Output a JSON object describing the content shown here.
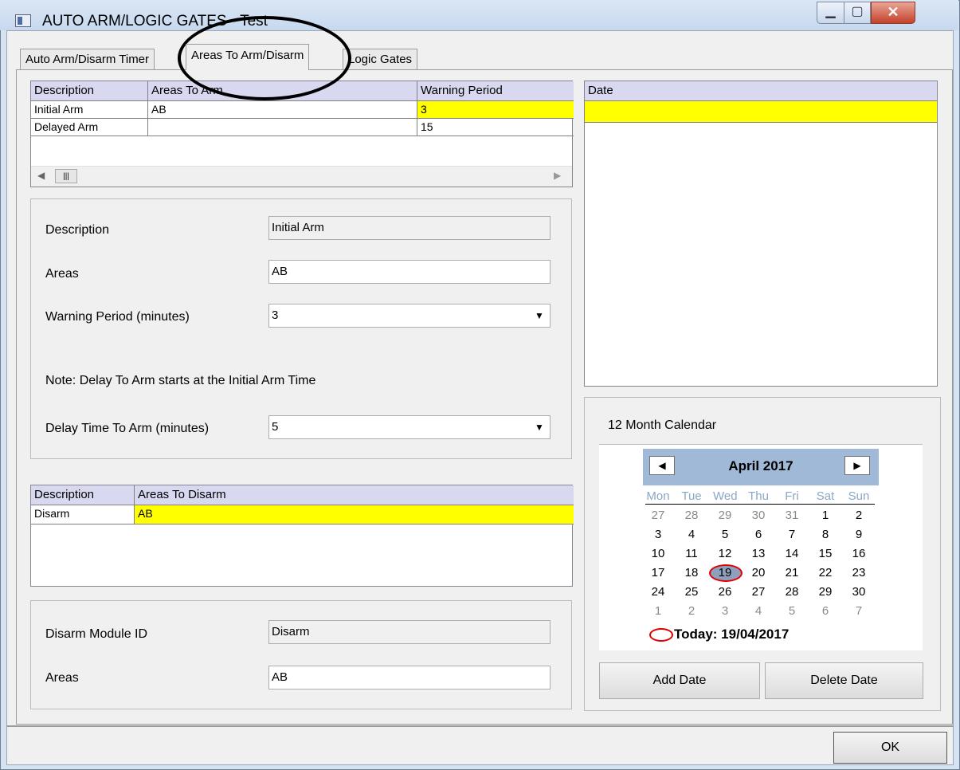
{
  "window": {
    "title": "AUTO ARM/LOGIC GATES - Test"
  },
  "tabs": [
    {
      "label": "Auto Arm/Disarm Timer"
    },
    {
      "label": "Areas To Arm/Disarm"
    },
    {
      "label": "Logic Gates"
    }
  ],
  "arm_grid": {
    "headers": [
      "Description",
      "Areas To Arm",
      "Warning Period"
    ],
    "rows": [
      {
        "description": "Initial Arm",
        "areas": "AB",
        "warning": "3"
      },
      {
        "description": "Delayed Arm",
        "areas": "",
        "warning": "15"
      }
    ]
  },
  "arm_details": {
    "description_label": "Description",
    "description_value": "Initial Arm",
    "areas_label": "Areas",
    "areas_value": "AB",
    "warning_label": "Warning Period (minutes)",
    "warning_value": "3",
    "note": "Note: Delay To Arm starts at the Initial Arm Time",
    "delay_label": "Delay Time To Arm (minutes)",
    "delay_value": "5"
  },
  "disarm_grid": {
    "headers": [
      "Description",
      "Areas To Disarm"
    ],
    "rows": [
      {
        "description": "Disarm",
        "areas": "AB"
      }
    ]
  },
  "disarm_details": {
    "module_label": "Disarm Module ID",
    "module_value": "Disarm",
    "areas_label": "Areas",
    "areas_value": "AB"
  },
  "date_grid": {
    "header": "Date"
  },
  "calendar": {
    "label": "12 Month Calendar",
    "month": "April 2017",
    "weekdays": [
      "Mon",
      "Tue",
      "Wed",
      "Thu",
      "Fri",
      "Sat",
      "Sun"
    ],
    "weeks": [
      [
        "27",
        "28",
        "29",
        "30",
        "31",
        "1",
        "2"
      ],
      [
        "3",
        "4",
        "5",
        "6",
        "7",
        "8",
        "9"
      ],
      [
        "10",
        "11",
        "12",
        "13",
        "14",
        "15",
        "16"
      ],
      [
        "17",
        "18",
        "19",
        "20",
        "21",
        "22",
        "23"
      ],
      [
        "24",
        "25",
        "26",
        "27",
        "28",
        "29",
        "30"
      ],
      [
        "1",
        "2",
        "3",
        "4",
        "5",
        "6",
        "7"
      ]
    ],
    "today": "Today: 19/04/2017"
  },
  "buttons": {
    "add_date": "Add Date",
    "delete_date": "Delete Date",
    "ok": "OK"
  },
  "colors": {
    "highlight": "#ffff00",
    "grid_header": "#d8d8f0",
    "calendar_header": "#9fb9d6",
    "today_marker": "#e00000"
  }
}
